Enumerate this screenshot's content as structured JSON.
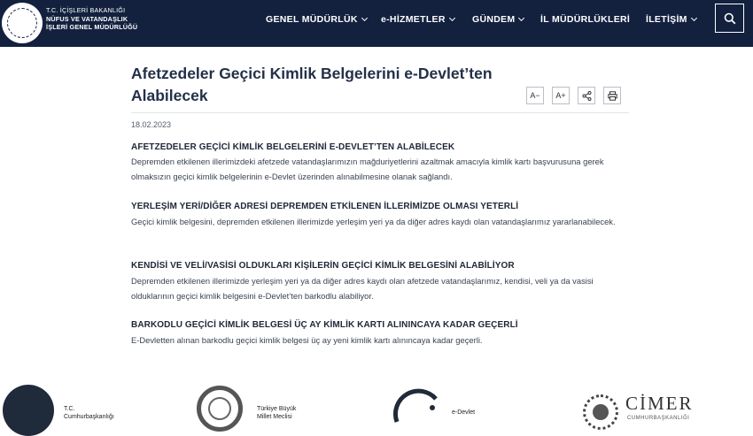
{
  "header": {
    "brand_line1": "T.C. İÇİŞLERİ BAKANLIĞI",
    "brand_line2": "NÜFUS VE VATANDAŞLIK",
    "brand_line3": "İŞLERİ GENEL MÜDÜRLÜĞÜ",
    "nav": [
      {
        "label": "GENEL MÜDÜRLÜK",
        "has_dropdown": true
      },
      {
        "label": "e-HİZMETLER",
        "has_dropdown": true
      },
      {
        "label": "GÜNDEM",
        "has_dropdown": true
      },
      {
        "label": "İL MÜDÜRLÜKLERİ",
        "has_dropdown": false
      },
      {
        "label": "İLETİŞİM",
        "has_dropdown": true
      }
    ]
  },
  "article": {
    "title": "Afetzedeler Geçici Kimlik Belgelerini e-Devlet’ten Alabilecek",
    "date": "18.02.2023",
    "tools": [
      "A−",
      "A+",
      "share-icon",
      "print-icon"
    ],
    "sections": [
      {
        "heading": "AFETZEDELER GEÇİCİ KİMLİK BELGELERİNİ E-DEVLET’TEN ALABİLECEK",
        "body": "Depremden etkilenen illerimizdeki afetzede vatandaşlarımızın mağduriyetlerini azaltmak amacıyla kimlik kartı başvurusuna gerek olmaksızın geçici kimlik belgelerinin e-Devlet üzerinden alınabilmesine olanak sağlandı."
      },
      {
        "heading": "YERLEŞİM YERİ/DİĞER ADRESİ DEPREMDEN ETKİLENEN İLLERİMİZDE OLMASI YETERLİ",
        "body": "Geçici kimlik belgesini, depremden etkilenen illerimizde yerleşim yeri ya da diğer adres kaydı olan vatandaşlarımız yararlanabilecek."
      },
      {
        "heading": "KENDİSİ VE VELİ/VASİSİ OLDUKLARI KİŞİLERİN GEÇİCİ KİMLİK BELGESİNİ ALABİLİYOR",
        "body": "Depremden etkilenen illerimizde yerleşim yeri ya da diğer adres kaydı olan afetzede vatandaşlarımız, kendisi, veli ya da vasisi olduklarının geçici kimlik belgesini e-Devlet’ten barkodlu alabiliyor."
      },
      {
        "heading": "BARKODLU GEÇİCİ KİMLİK BELGESİ ÜÇ AY KİMLİK KARTI ALININCAYA KADAR GEÇERLİ",
        "body": "E-Devletten alınan barkodlu geçici kimlik belgesi üç ay yeni kimlik kartı alınıncaya kadar geçerli."
      }
    ]
  },
  "footer": {
    "logos": [
      {
        "line1": "T.C.",
        "line2": "Cumhurbaşkanlığı"
      },
      {
        "line1": "Türkiye Büyük",
        "line2": "Millet Meclisi"
      },
      {
        "line1": "e-Devlet",
        "line2": ""
      },
      {
        "line1": "CİMER",
        "line2": "CUMHURBAŞKANLIĞI"
      }
    ]
  },
  "colors": {
    "header_bg": "#13213f",
    "title": "#233048"
  }
}
